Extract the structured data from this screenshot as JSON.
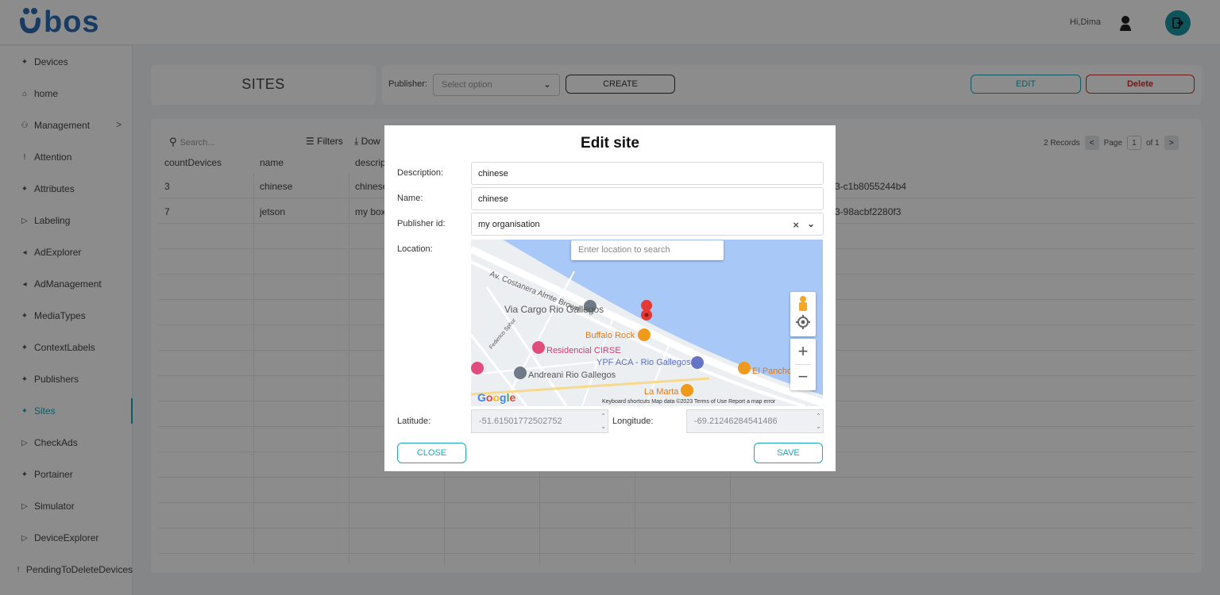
{
  "header": {
    "logo_text": "ubos",
    "user_greeting": "Hi,Dima",
    "logout_icon": "logout-icon"
  },
  "sidebar": {
    "items": [
      {
        "label": "Devices",
        "icon": "sparkle-icon"
      },
      {
        "label": "home",
        "icon": "home-icon"
      },
      {
        "label": "Management",
        "icon": "people-icon"
      },
      {
        "label": "Attention",
        "icon": "exclamation-icon"
      },
      {
        "label": "Attributes",
        "icon": "sparkle-icon"
      },
      {
        "label": "Labeling",
        "icon": "tag-icon"
      },
      {
        "label": "AdExplorer",
        "icon": "megaphone-icon"
      },
      {
        "label": "AdManagement",
        "icon": "megaphone-icon"
      },
      {
        "label": "MediaTypes",
        "icon": "sparkle-icon"
      },
      {
        "label": "ContextLabels",
        "icon": "sparkle-icon"
      },
      {
        "label": "Publishers",
        "icon": "sparkle-icon"
      },
      {
        "label": "Sites",
        "icon": "sparkle-icon"
      },
      {
        "label": "CheckAds",
        "icon": "tag-icon"
      },
      {
        "label": "Portainer",
        "icon": "sparkle-icon"
      },
      {
        "label": "Simulator",
        "icon": "tag-icon"
      },
      {
        "label": "DeviceExplorer",
        "icon": "tag-icon"
      },
      {
        "label": "PendingToDeleteDevices",
        "icon": "exclamation-icon"
      }
    ],
    "active": "Sites"
  },
  "page": {
    "title": "SITES",
    "publisher_label": "Publisher:",
    "publisher_placeholder": "Select option",
    "create_label": "CREATE",
    "edit_label": "EDIT",
    "delete_label": "Delete"
  },
  "table": {
    "search_placeholder": "Search...",
    "filters_label": "Filters",
    "download_label": "Dow",
    "records": "2 Records",
    "page_label": "Page",
    "page_current": "1",
    "page_total": "of 1",
    "columns": [
      "countDevices",
      "name",
      "descrip"
    ],
    "rows": [
      {
        "countDevices": "3",
        "name": "chinese",
        "description": "chinese",
        "id_tail": "3-c1b8055244b4"
      },
      {
        "countDevices": "7",
        "name": "jetson",
        "description": "my box",
        "id_tail": "3-98acbf2280f3"
      }
    ]
  },
  "modal": {
    "title": "Edit site",
    "description_label": "Description:",
    "description_value": "chinese",
    "name_label": "Name:",
    "name_value": "chinese",
    "publisher_label": "Publisher id:",
    "publisher_value": "my organisation",
    "location_label": "Location:",
    "map_search_placeholder": "Enter location to search",
    "map_labels": {
      "street": "Av. Costanera Almte Brown",
      "via_cargo": "Via Cargo Rio Gallegos",
      "buffalo": "Buffalo Rock",
      "residencial": "Residencial CIRSE",
      "ypf": "YPF ACA - Rio Gallegos",
      "el_pancho": "El Pancho",
      "andreani": "Andreani Rio Gallegos",
      "la_marta": "La Marta",
      "federico": "Federico Sphur"
    },
    "map_footer": "Keyboard shortcuts   Map data ©2023   Terms of Use   Report a map error",
    "map_brand": "Google",
    "latitude_label": "Latitude:",
    "latitude_value": "-51.61501772502752",
    "longitude_label": "Longitude:",
    "longitude_value": "-69.21246284541486",
    "close_label": "CLOSE",
    "save_label": "SAVE"
  },
  "colors": {
    "accent": "#1aa7b8",
    "danger": "#d32f2f",
    "water": "#a8c8f8"
  }
}
